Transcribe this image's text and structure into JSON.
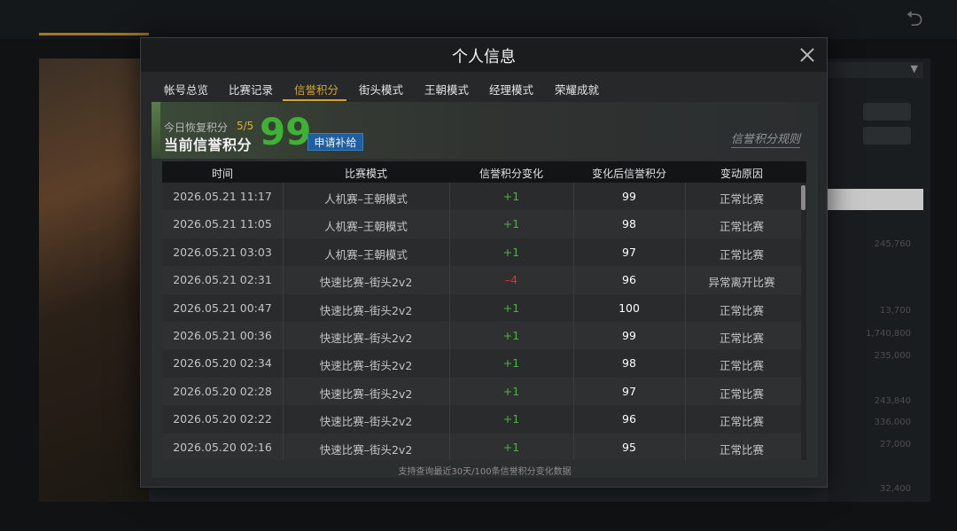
{
  "modal": {
    "title": "个人信息",
    "close_icon": "close-icon",
    "tabs": [
      {
        "label": "帐号总览"
      },
      {
        "label": "比赛记录"
      },
      {
        "label": "信誉积分",
        "active": true
      },
      {
        "label": "街头模式"
      },
      {
        "label": "王朝模式"
      },
      {
        "label": "经理模式"
      },
      {
        "label": "荣耀成就"
      }
    ],
    "accent_color": "#d8a431"
  },
  "credit": {
    "recover_label": "今日恢复积分",
    "recover_count": "5/5",
    "label": "当前信誉积分",
    "value": "99",
    "value_color": "#3fb134",
    "apply_button": "申请补给",
    "rules_link": "信誉积分规则"
  },
  "table": {
    "columns": [
      "时间",
      "比赛模式",
      "信誉积分变化",
      "变化后信誉积分",
      "变动原因"
    ],
    "rows": [
      {
        "time": "2026.05.21  11:17",
        "mode": "人机赛–王朝模式",
        "delta": "+1",
        "after": "99",
        "reason": "正常比赛"
      },
      {
        "time": "2026.05.21  11:05",
        "mode": "人机赛–王朝模式",
        "delta": "+1",
        "after": "98",
        "reason": "正常比赛"
      },
      {
        "time": "2026.05.21  03:03",
        "mode": "人机赛–王朝模式",
        "delta": "+1",
        "after": "97",
        "reason": "正常比赛"
      },
      {
        "time": "2026.05.21  02:31",
        "mode": "快速比赛–街头2v2",
        "delta": "–4",
        "after": "96",
        "reason": "异常离开比赛"
      },
      {
        "time": "2026.05.21  00:47",
        "mode": "快速比赛–街头2v2",
        "delta": "+1",
        "after": "100",
        "reason": "正常比赛"
      },
      {
        "time": "2026.05.21  00:36",
        "mode": "快速比赛–街头2v2",
        "delta": "+1",
        "after": "99",
        "reason": "正常比赛"
      },
      {
        "time": "2026.05.20  02:34",
        "mode": "快速比赛–街头2v2",
        "delta": "+1",
        "after": "98",
        "reason": "正常比赛"
      },
      {
        "time": "2026.05.20  02:28",
        "mode": "快速比赛–街头2v2",
        "delta": "+1",
        "after": "97",
        "reason": "正常比赛"
      },
      {
        "time": "2026.05.20  02:22",
        "mode": "快速比赛–街头2v2",
        "delta": "+1",
        "after": "96",
        "reason": "正常比赛"
      },
      {
        "time": "2026.05.20  02:16",
        "mode": "快速比赛–街头2v2",
        "delta": "+1",
        "after": "95",
        "reason": "正常比赛"
      }
    ],
    "positive_color": "#43b93a",
    "negative_color": "#d03a2e",
    "footer_note": "支持查询最近30天/100条信誉积分变化数据"
  },
  "background": {
    "back_icon": "back-arrow-icon",
    "side_values": [
      "245,760",
      "13,700",
      "1,740,800",
      "235,000",
      "243,840",
      "336,000",
      "27,000",
      "32,400"
    ]
  }
}
